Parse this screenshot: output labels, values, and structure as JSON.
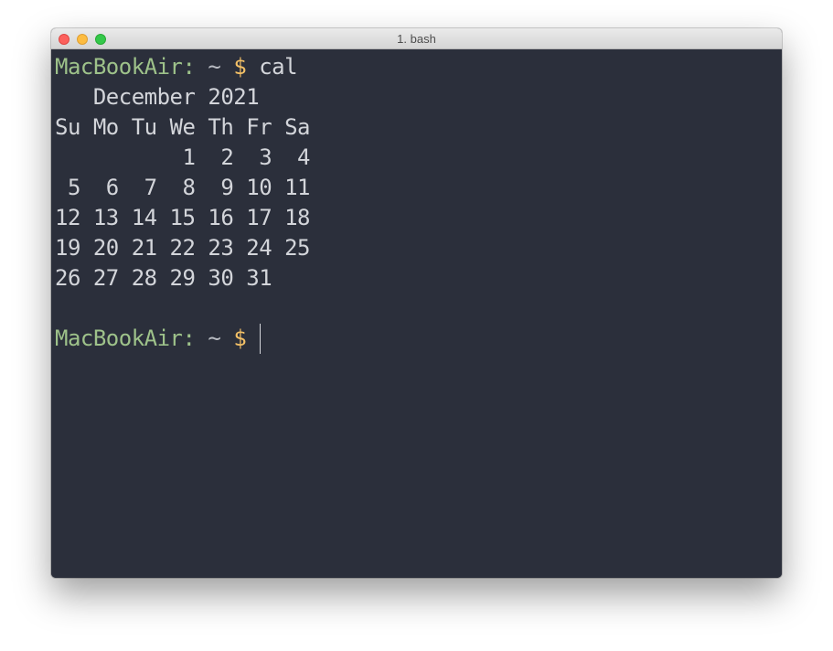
{
  "window": {
    "title": "1. bash"
  },
  "terminal": {
    "prompt": {
      "host": "MacBookAir:",
      "path": "~",
      "symbol": "$"
    },
    "command": "cal",
    "output": [
      "   December 2021",
      "Su Mo Tu We Th Fr Sa",
      "          1  2  3  4",
      " 5  6  7  8  9 10 11",
      "12 13 14 15 16 17 18",
      "19 20 21 22 23 24 25",
      "26 27 28 29 30 31",
      ""
    ]
  },
  "colors": {
    "background": "#2b2f3b",
    "host": "#9ec28a",
    "dollar": "#f3c066",
    "text": "#d3d5da"
  }
}
